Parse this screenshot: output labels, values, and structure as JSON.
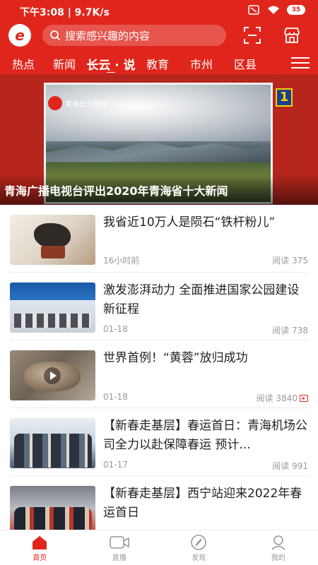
{
  "status_bar": {
    "time_speed": "下午3:08 | 9.7K/s",
    "battery": "35"
  },
  "header": {
    "logo_glyph": "e",
    "search_placeholder": "搜索感兴趣的内容",
    "scan_icon": "scan-icon",
    "store_icon": "store-icon",
    "accent": "#e0261c"
  },
  "tabs": [
    {
      "label": "热点"
    },
    {
      "label": "新闻"
    },
    {
      "label": "长云 · 说",
      "active": true
    },
    {
      "label": "教育"
    },
    {
      "label": "市州"
    },
    {
      "label": "区县"
    }
  ],
  "banner": {
    "title": "青海广播电视台评出2020年青海省十大新闻",
    "overlay_text": "2020年青海省十大新闻",
    "brand": "青海长云网络",
    "badge": "1"
  },
  "news": [
    {
      "headline": "我省近10万人是陨石“铁杆粉儿”",
      "time": "16小时前",
      "reads": "阅读 375",
      "video": false
    },
    {
      "headline": "激发澎湃动力 全面推进国家公园建设新征程",
      "time": "01-18",
      "reads": "阅读 738",
      "video": false
    },
    {
      "headline": "世界首例！“黄蓉”放归成功",
      "time": "01-18",
      "reads": "阅读 3840",
      "video": true
    },
    {
      "headline": "【新春走基层】春运首日：青海机场公司全力以赴保障春运 预计...",
      "time": "01-17",
      "reads": "阅读 991",
      "video": false
    },
    {
      "headline": "【新春走基层】西宁站迎来2022年春运首日",
      "time": "",
      "reads": "",
      "video": false
    }
  ],
  "bottom_nav": [
    {
      "label": "首页",
      "icon": "home-icon",
      "active": true
    },
    {
      "label": "直播",
      "icon": "video-camera-icon",
      "active": false
    },
    {
      "label": "发现",
      "icon": "compass-icon",
      "active": false
    },
    {
      "label": "我的",
      "icon": "profile-icon",
      "active": false
    }
  ]
}
